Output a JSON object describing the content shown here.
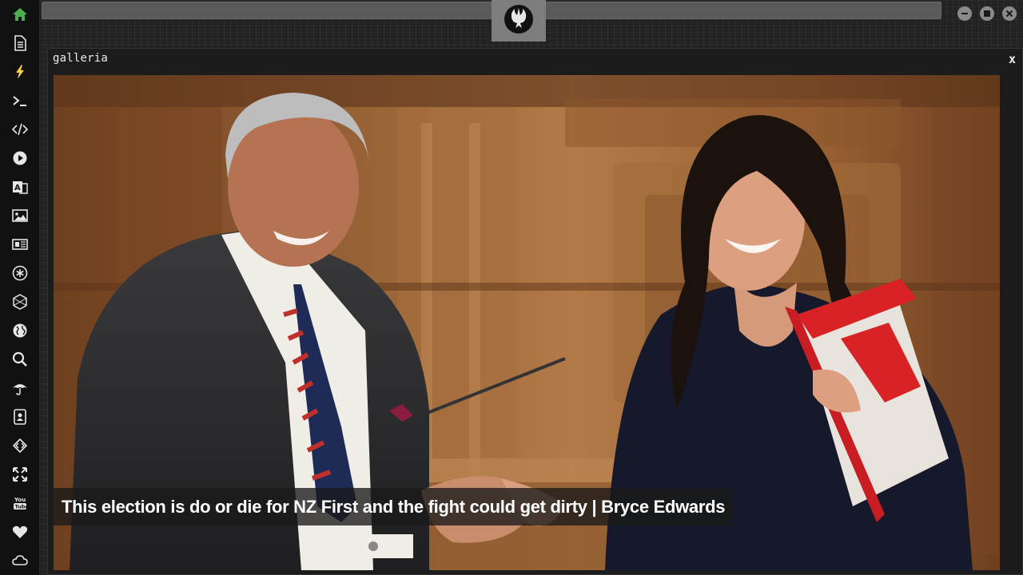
{
  "window": {
    "title": "galleria",
    "close_label": "x"
  },
  "gallery": {
    "caption": "This election is do or die for NZ First and the fight could get dirty | Bryce Edwards"
  },
  "sidebar": {
    "items": [
      {
        "icon": "home-icon",
        "color": "#4caf50"
      },
      {
        "icon": "document-icon",
        "color": "#e6e6e6"
      },
      {
        "icon": "lightning-icon",
        "color": "#f5d33b"
      },
      {
        "icon": "terminal-icon",
        "color": "#e6e6e6"
      },
      {
        "icon": "code-icon",
        "color": "#e6e6e6"
      },
      {
        "icon": "play-icon",
        "color": "#e6e6e6"
      },
      {
        "icon": "translate-icon",
        "color": "#e6e6e6"
      },
      {
        "icon": "image-icon",
        "color": "#e6e6e6"
      },
      {
        "icon": "newspaper-icon",
        "color": "#e6e6e6"
      },
      {
        "icon": "asterisk-icon",
        "color": "#e6e6e6"
      },
      {
        "icon": "hexagon-icon",
        "color": "#e6e6e6"
      },
      {
        "icon": "globe-icon",
        "color": "#e6e6e6"
      },
      {
        "icon": "search-icon",
        "color": "#e6e6e6"
      },
      {
        "icon": "umbrella-icon",
        "color": "#e6e6e6"
      },
      {
        "icon": "contact-card-icon",
        "color": "#e6e6e6"
      },
      {
        "icon": "diamond-code-icon",
        "color": "#e6e6e6"
      },
      {
        "icon": "expand-icon",
        "color": "#e6e6e6"
      },
      {
        "icon": "youtube-icon",
        "color": "#e6e6e6"
      },
      {
        "icon": "heart-icon",
        "color": "#e6e6e6"
      },
      {
        "icon": "cloud-icon",
        "color": "#e6e6e6"
      }
    ]
  },
  "topbar": {
    "logo_icon": "rebel-alliance-icon",
    "controls": [
      "minimize-icon",
      "maximize-icon",
      "close-icon"
    ]
  }
}
